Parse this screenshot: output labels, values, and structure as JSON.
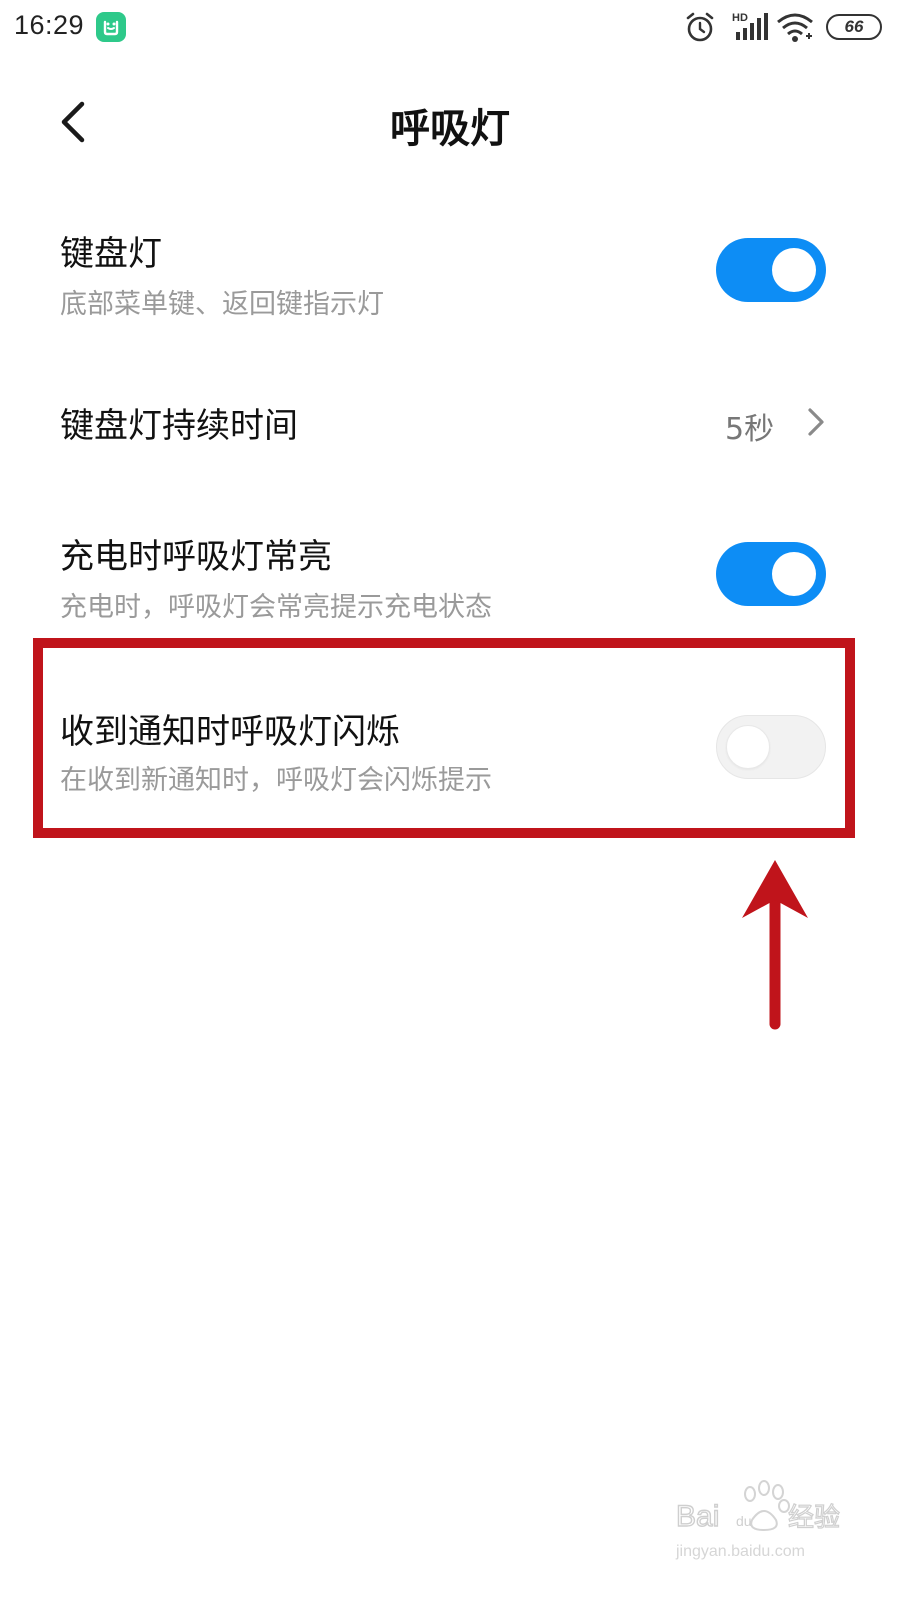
{
  "status_bar": {
    "time": "16:29",
    "battery": "66",
    "signal_label": "HD",
    "icons": [
      "mi-home-app-icon",
      "alarm-icon",
      "signal-icon",
      "wifi-icon",
      "battery-icon"
    ]
  },
  "header": {
    "title": "呼吸灯",
    "back_icon": "chevron-left-icon"
  },
  "settings": [
    {
      "title": "键盘灯",
      "description": "底部菜单键、返回键指示灯",
      "control": "toggle",
      "enabled": true
    },
    {
      "title": "键盘灯持续时间",
      "value": "5秒",
      "control": "disclosure"
    },
    {
      "title": "充电时呼吸灯常亮",
      "description": "充电时，呼吸灯会常亮提示充电状态",
      "control": "toggle",
      "enabled": true
    },
    {
      "title": "收到通知时呼吸灯闪烁",
      "description": "在收到新通知时，呼吸灯会闪烁提示",
      "control": "toggle",
      "enabled": false
    }
  ],
  "annotation": {
    "highlight_color": "#c0141b",
    "type": "box-and-up-arrow"
  },
  "colors": {
    "toggle_on": "#0d8df5",
    "toggle_off": "#f2f2f2",
    "secondary_text": "#9a9a9a"
  },
  "watermark": {
    "brand": "Bai",
    "brand_suffix": "du",
    "product": "经验",
    "url": "jingyan.baidu.com"
  }
}
